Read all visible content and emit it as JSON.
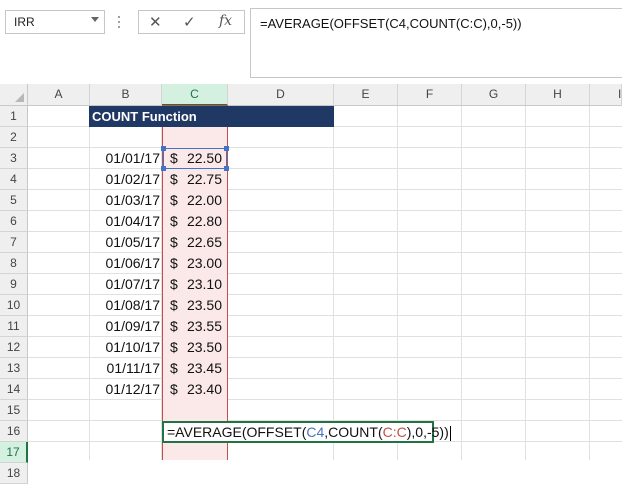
{
  "namebox": {
    "value": "IRR"
  },
  "formula_bar": {
    "cancel_glyph": "✕",
    "enter_glyph": "✓",
    "fx_glyph": "fx",
    "formula": "=AVERAGE(OFFSET(C4,COUNT(C:C),0,-5))"
  },
  "columns": [
    "A",
    "B",
    "C",
    "D",
    "E",
    "F",
    "G",
    "H",
    "I"
  ],
  "rows": [
    "1",
    "2",
    "3",
    "4",
    "5",
    "6",
    "7",
    "8",
    "9",
    "10",
    "11",
    "12",
    "13",
    "14",
    "15",
    "16",
    "17",
    "18"
  ],
  "title": "COUNT Function",
  "dates": [
    "01/01/17",
    "01/02/17",
    "01/03/17",
    "01/04/17",
    "01/05/17",
    "01/06/17",
    "01/07/17",
    "01/08/17",
    "01/09/17",
    "01/10/17",
    "01/11/17",
    "01/12/17"
  ],
  "currency_symbol": "$",
  "prices": [
    "22.50",
    "22.75",
    "22.00",
    "22.80",
    "22.65",
    "23.00",
    "23.10",
    "23.50",
    "23.55",
    "23.50",
    "23.45",
    "23.40"
  ],
  "edit_cell": {
    "p1": "=AVERAGE(OFFSET(",
    "ref1": "C4",
    "p2": ",COUNT(",
    "ref2": "C:C",
    "p3": "),0,-5))"
  },
  "colors": {
    "header_fill": "#1f3864",
    "selection": "#217346",
    "ref_blue": "#4472c4",
    "ref_red": "#c0504d"
  }
}
